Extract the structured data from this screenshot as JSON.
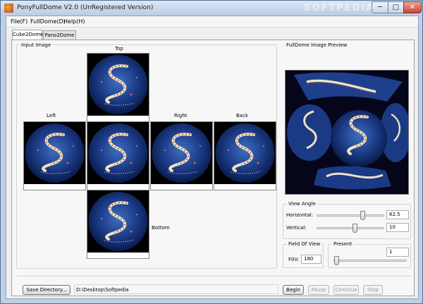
{
  "window": {
    "title": "PonyFullDome V2.0 (UnRegistered Version)",
    "watermark": "SOFTPEDIA",
    "buttons": {
      "minimize": "─",
      "maximize": "□",
      "close": "✕"
    }
  },
  "menu": [
    "File(F)",
    "FullDome(D)",
    "Help(H)"
  ],
  "tabs": [
    {
      "label": "Cube2Dome",
      "active": true
    },
    {
      "label": "Pano2Dome",
      "active": false
    }
  ],
  "input_image": {
    "title": "Input Image",
    "faces": {
      "top": "Top",
      "left": "Left",
      "right": "Right",
      "back": "Back",
      "bottom": "Bottom"
    }
  },
  "preview": {
    "title": "FullDome Image Preview"
  },
  "view_angle": {
    "title": "View Angle",
    "horizontal_label": "Horizontal:",
    "horizontal_value": "62.5",
    "vertical_label": "Vertical:",
    "vertical_value": "10"
  },
  "fov": {
    "title": "Field Of View",
    "label": "F0V:",
    "value": "180"
  },
  "present": {
    "title": "Present",
    "value": "1"
  },
  "bottom_bar": {
    "save_directory_label": "Save Directory...",
    "path": "D:\\Desktop\\Softpedia",
    "begin": "Begin",
    "pause": "Pause",
    "continue": "Continue",
    "stop": "Stop"
  },
  "colors": {
    "titlebar": "#c6d7eb",
    "panel": "#f7f7f7",
    "space": "#0f2560"
  }
}
